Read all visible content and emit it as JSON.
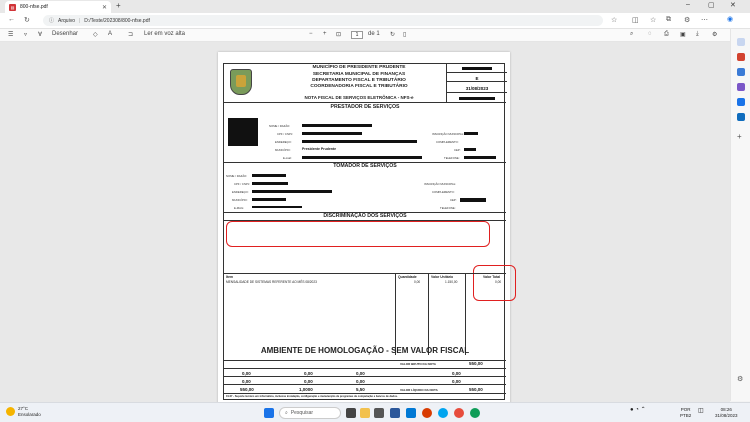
{
  "browser": {
    "tab_title": "800-nfse.pdf",
    "url_label": "Arquivo",
    "url_path": "D:/Teste/202308/800-nfse.pdf"
  },
  "pdf_toolbar": {
    "draw_label": "Desenhar",
    "read_aloud_label": "Ler em voz alta",
    "page_current": "1",
    "page_total": "de 1"
  },
  "nfse": {
    "header_lines": [
      "MUNICÍPIO DE PRESIDENTE PRUDENTE",
      "SECRETARIA MUNICIPAL DE FINANÇAS",
      "DEPARTAMENTO FISCAL E TRIBUTÁRIO",
      "COORDENADORIA FISCAL E TRIBUTÁRIO"
    ],
    "doc_title": "NOTA FISCAL DE SERVIÇOS ELETRÔNICA - NFS-e",
    "serie_value": "E",
    "date_value": "31/08/2023",
    "prestador_title": "PRESTADOR DE SERVIÇOS",
    "prestador_labels": {
      "nome": "NOME / RAZÃO:",
      "cpf": "CPF / CNPJ:",
      "endereco": "ENDEREÇO:",
      "municipio": "MUNICÍPIO:",
      "email": "E-mail:",
      "inscricao": "INSCRIÇÃO MUNICIPAL:",
      "complemento": "COMPLEMENTO:",
      "cep": "CEP:",
      "telefone": "TELEFONE:"
    },
    "prestador_municipio": "Presidente Prudente",
    "tomador_title": "TOMADOR DE SERVIÇOS",
    "tomador_labels": {
      "nome": "NOME / RAZÃO:",
      "cpf": "CPF / CNPJ:",
      "endereco": "ENDEREÇO:",
      "municipio": "MUNICÍPIO:",
      "email": "E-MAIL:",
      "inscricao": "INSCRIÇÃO MUNICIPAL:",
      "complemento": "COMPLEMENTO:",
      "cep": "CEP:",
      "telefone": "TELEFONE:"
    },
    "discriminacao_title": "DISCRIMINAÇÃO DOS SERVIÇOS",
    "services_headers": {
      "item": "Item",
      "quantidade": "Quantidade",
      "valor_unitario": "Valor Unitário",
      "valor_total": "Valor Total"
    },
    "services_rows": [
      {
        "item": "MENSALIDADE DE SISTEMAS REFERENTE AO MÊS 08/2023",
        "quantidade": "0,00",
        "valor_unitario": "1.150,00",
        "valor_total": "0,00"
      }
    ],
    "homologacao": "AMBIENTE DE HOMOLOGAÇÃO - SEM VALOR FISCAL",
    "valor_bruto_label": "VALOR BRUTO DA NOTA",
    "valor_bruto": "550,00",
    "valor_liquido_label": "VALOR LÍQUIDO DA NOTA",
    "valor_liquido": "550,00",
    "totals_row1": [
      "0,00",
      "0,00",
      "0,00",
      "0,00"
    ],
    "totals_row2": [
      "0,00",
      "0,00",
      "0,00",
      "0,00"
    ],
    "totals_row3": [
      "550,00",
      "1,0000",
      "5,50"
    ],
    "footer_line": "01.07 - Suporte técnico em informática, inclusive instalação, configuração e manutenção de programas de computação e bancos de dados."
  },
  "taskbar": {
    "temp": "27°C",
    "weather_desc": "Ensolarado",
    "search_placeholder": "Pesquisar",
    "lang": "POR",
    "lang2": "PTB2",
    "time": "08:26",
    "date": "31/08/2023"
  },
  "colors": {
    "annotation_red": "#e02020",
    "pdf_icon": "#d13438"
  }
}
